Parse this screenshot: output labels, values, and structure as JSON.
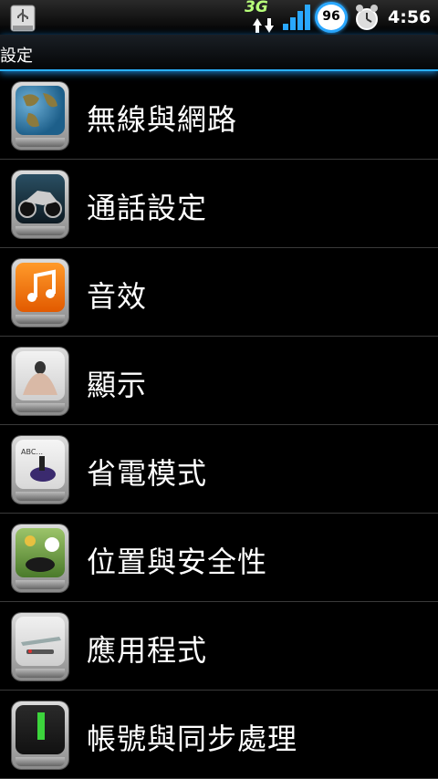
{
  "status_bar": {
    "network_type": "3G",
    "battery_level": "96",
    "time": "4:56"
  },
  "title_bar": {
    "title": "設定"
  },
  "settings_items": [
    {
      "label": "無線與網路",
      "icon": "globe-icon"
    },
    {
      "label": "通話設定",
      "icon": "motorcycle-icon"
    },
    {
      "label": "音效",
      "icon": "music-note-icon"
    },
    {
      "label": "顯示",
      "icon": "display-figure-icon"
    },
    {
      "label": "省電模式",
      "icon": "ink-bottle-icon"
    },
    {
      "label": "位置與安全性",
      "icon": "golf-hole-icon"
    },
    {
      "label": "應用程式",
      "icon": "airplane-icon"
    },
    {
      "label": "帳號與同步處理",
      "icon": "sync-icon"
    }
  ],
  "colors": {
    "accent": "#2ab0ff",
    "divider": "#3a3a3a"
  }
}
